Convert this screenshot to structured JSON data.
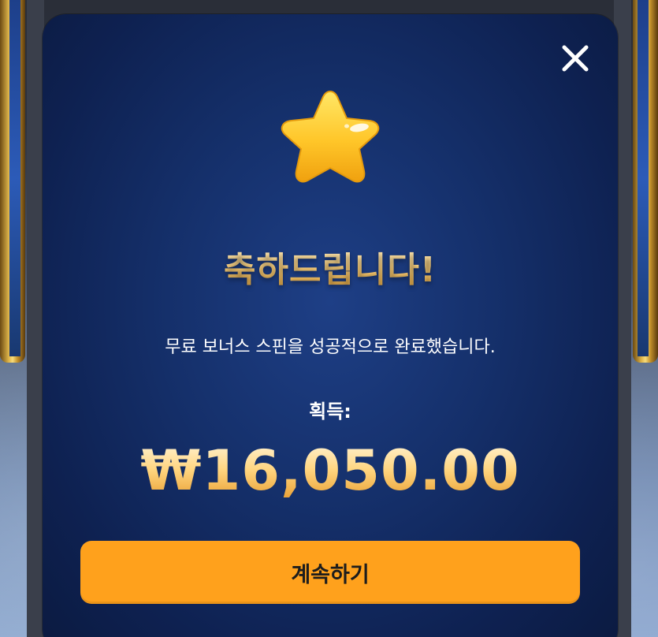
{
  "modal": {
    "title": "축하드립니다!",
    "message": "무료 보너스 스핀을 성공적으로 완료했습니다.",
    "earned_label": "획득:",
    "amount": "₩16,050.00",
    "continue_label": "계속하기",
    "close_icon": "close-icon",
    "star_icon": "star-icon"
  },
  "colors": {
    "accent": "#ffa11c",
    "modal_bg": "#15306b",
    "title_gold": "#ffd27a"
  }
}
